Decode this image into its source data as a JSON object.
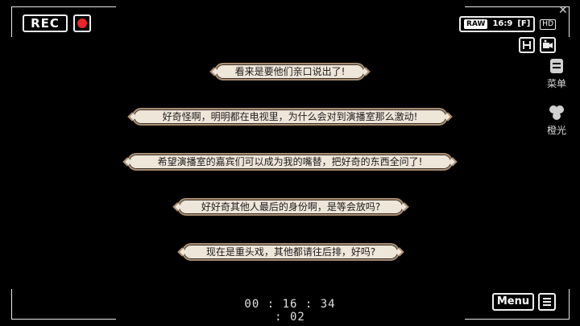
{
  "recorder": {
    "rec_label": "REC",
    "aspect": "16:9",
    "flash": "[F]",
    "raw": "RAW",
    "hd": "HD",
    "timecode": "00 : 16 : 34 : 02"
  },
  "side_menu": {
    "menu_label": "菜单",
    "orange_label": "橙光"
  },
  "dialogue": [
    "看来是要他们亲口说出了!",
    "好奇怪啊，明明都在电视里，为什么会对到演播室那么激动!",
    "希望演播室的嘉宾们可以成为我的嘴替，把好奇的东西全问了!",
    "好好奇其他人最后的身份啊，是等会放吗?",
    "现在是重头戏，其他都请往后排，好吗?"
  ],
  "bottom_bar": {
    "menu_button": "Menu"
  },
  "colors": {
    "rec_dot": "#e8262b",
    "bubble_fill": "#efe6da",
    "bubble_border": "#a98e73"
  }
}
